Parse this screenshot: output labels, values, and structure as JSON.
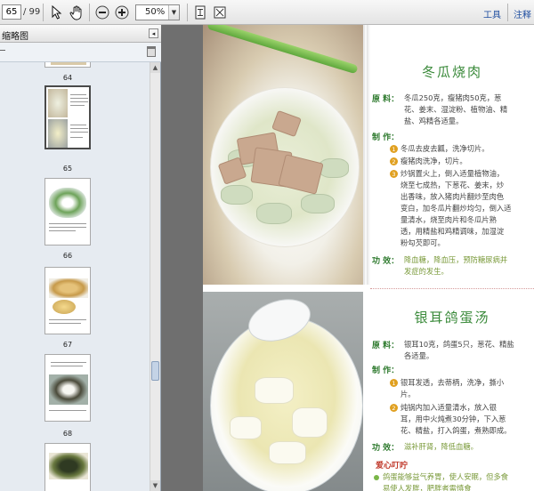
{
  "toolbar": {
    "current_page": "65",
    "total_pages": "/ 99",
    "zoom": "50%",
    "tools_label": "工具",
    "comment_label": "注释"
  },
  "panel": {
    "title": "缩略图",
    "thumbnails": [
      {
        "label": "64"
      },
      {
        "label": "65"
      },
      {
        "label": "66"
      },
      {
        "label": "67"
      },
      {
        "label": "68"
      }
    ]
  },
  "page": {
    "dish1": {
      "title": "冬瓜烧肉",
      "ingredients_label": "原 料：",
      "ingredients_lines": [
        "冬瓜250克，瘦猪肉50克，葱",
        "花、姜末、湿淀粉、植物油、精",
        "盐、鸡精各适量。"
      ],
      "method_label": "制 作：",
      "steps": [
        {
          "num": "1",
          "lines": [
            "冬瓜去皮去瓤，洗净切片。"
          ]
        },
        {
          "num": "2",
          "lines": [
            "瘦猪肉洗净，切片。"
          ]
        },
        {
          "num": "3",
          "lines": [
            "炒锅置火上，倒入适量植物油，",
            "烧至七成热，下葱花、姜末，炒",
            "出香味，放入猪肉片翻炒至肉色",
            "变白，加冬瓜片翻炒均匀，倒入适",
            "量清水，烧至肉片和冬瓜片熟",
            "透，用精盐和鸡精调味，加湿淀",
            "粉勾芡即可。"
          ]
        }
      ],
      "effect_label": "功 效：",
      "effect_lines": [
        "降血糖，降血压，预防糖尿病并",
        "发症的发生。"
      ]
    },
    "dish2": {
      "title": "银耳鸽蛋汤",
      "ingredients_label": "原 料：",
      "ingredients_lines": [
        "银耳10克，鸽蛋5只，葱花、精盐",
        "各适量。"
      ],
      "method_label": "制 作：",
      "steps": [
        {
          "num": "1",
          "lines": [
            "银耳发透，去蒂柄，洗净，撕小",
            "片。"
          ]
        },
        {
          "num": "2",
          "lines": [
            "炖锅内加入适量清水，放入银",
            "耳，用中火炖煮30分钟，下入葱",
            "花、精盐，打入鸽蛋，煮熟即成。"
          ]
        }
      ],
      "effect_label": "功 效：",
      "effect_lines": [
        "滋补肝肾，降低血糖。"
      ],
      "tips_title": "爱心叮咛",
      "tips_lines": [
        "鸽蛋能够益气养胃，使人安眠，但多食",
        "易使人发胖，肥胖者需慎食"
      ]
    }
  },
  "colors": {
    "accent_green": "#3a8a3a",
    "tip_red": "#c0392b",
    "step_badge": "#e0a020",
    "link_blue": "#1f4ea0"
  },
  "icons": [
    "select-arrow-icon",
    "hand-icon",
    "zoom-out-icon",
    "zoom-in-icon",
    "fit-page-icon",
    "fit-width-icon",
    "close-icon",
    "trash-icon",
    "scroll-up-icon",
    "scroll-down-icon"
  ]
}
